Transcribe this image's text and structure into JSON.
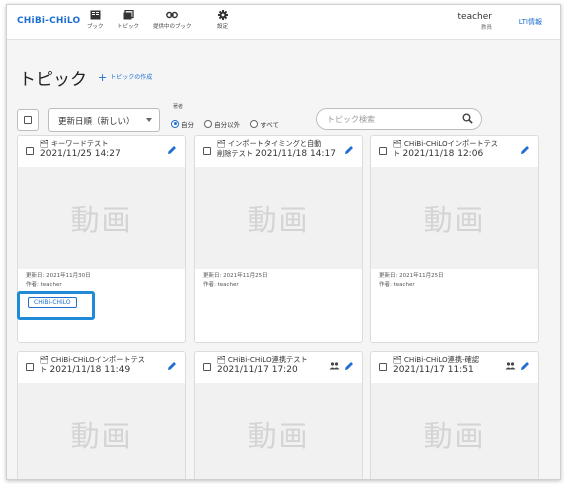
{
  "header": {
    "logo": "CHiBi-CHiLO",
    "nav": [
      {
        "label": "ブック",
        "icon": "book-icon"
      },
      {
        "label": "トピック",
        "icon": "topic-icon"
      },
      {
        "label": "提供中のブック",
        "icon": "link-icon"
      },
      {
        "label": "設定",
        "icon": "gear-icon"
      }
    ],
    "user_name": "teacher",
    "user_role": "教員",
    "lti_link": "LTI情報"
  },
  "page": {
    "title": "トピック",
    "create_label": "トピックの作成"
  },
  "toolbar": {
    "sort_value": "更新日順（新しい）",
    "owner_label": "著者",
    "owner_options": [
      "自分",
      "自分以外",
      "すべて"
    ],
    "owner_selected": "自分",
    "search_placeholder": "トピック検索"
  },
  "cards": [
    {
      "title": "キーワードテスト",
      "date": "2021/11/25 14:27",
      "thumb": "動画",
      "updated": "更新日: 2021年11月30日",
      "author": "作者: teacher",
      "tag": "CHiBi-CHiLO",
      "shared": false
    },
    {
      "title": "インポートタイミングと自動削除テスト",
      "title_line1": "インポートタイミングと自動",
      "title_line2": "削除テスト",
      "date": "2021/11/18 14:17",
      "thumb": "動画",
      "updated": "更新日: 2021年11月25日",
      "author": "作者: teacher",
      "shared": false
    },
    {
      "title_line1": "CHiBi-CHiLOインポートテス",
      "title_line2": "ト",
      "date": "2021/11/18 12:06",
      "thumb": "動画",
      "updated": "更新日: 2021年11月25日",
      "author": "作者: teacher",
      "shared": false
    },
    {
      "title_line1": "CHiBi-CHiLOインポートテス",
      "title_line2": "ト",
      "date": "2021/11/18 11:49",
      "thumb": "動画",
      "shared": false
    },
    {
      "title": "CHiBi-CHiLO連携テスト",
      "date": "2021/11/17 17:20",
      "thumb": "動画",
      "shared": true
    },
    {
      "title": "CHiBi-CHiLO連携-確認",
      "date": "2021/11/17 11:51",
      "thumb": "動画",
      "shared": true
    }
  ],
  "colors": {
    "accent": "#1e6fd0",
    "highlight": "#1f8ad6"
  }
}
